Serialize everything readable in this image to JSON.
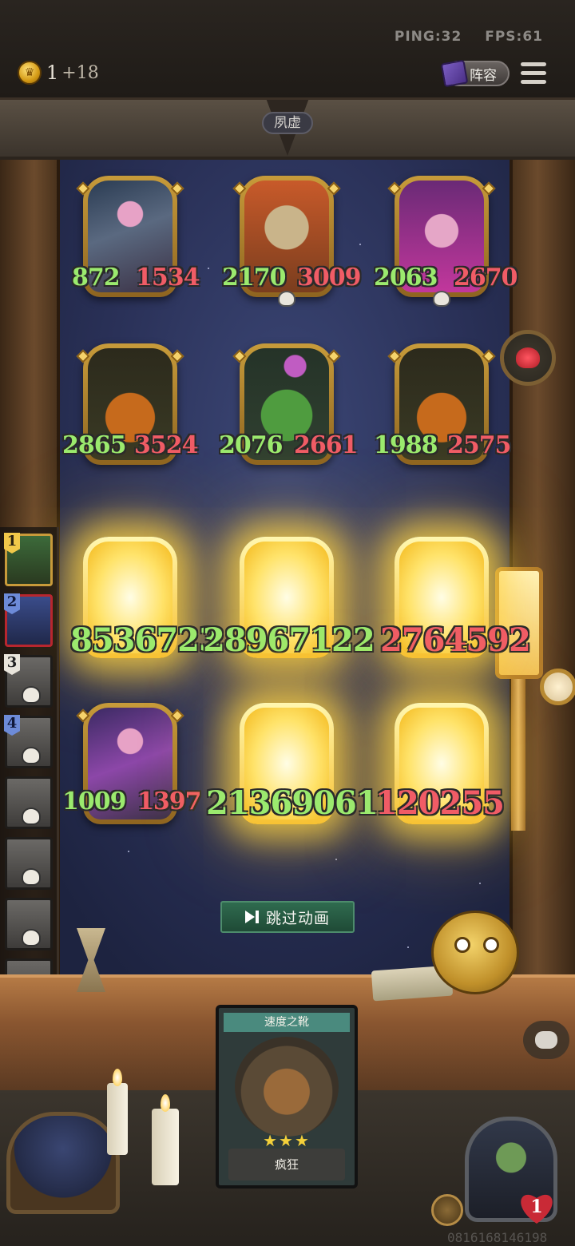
{
  "topbar": {
    "ping": "PING:32",
    "fps": "FPS:61",
    "gold_icon": "crown-coin-icon",
    "gold": "1",
    "gold_plus": "+18",
    "lineup_label": "阵容",
    "menu_icon": "hamburger-menu-icon"
  },
  "stage": {
    "name": "夙虚"
  },
  "units": [
    {
      "atk": "872",
      "hp": "1534",
      "portrait": "knight-woman"
    },
    {
      "atk": "2170",
      "hp": "3009",
      "portrait": "tree-ent"
    },
    {
      "atk": "2063",
      "hp": "2670",
      "portrait": "elf-girl"
    },
    {
      "atk": "2865",
      "hp": "3524",
      "portrait": "pumpkin-monster"
    },
    {
      "atk": "2076",
      "hp": "2661",
      "portrait": "cactus-monster"
    },
    {
      "atk": "1988",
      "hp": "2575",
      "portrait": "pumpkin-monster"
    },
    {
      "stats_text": "8536723",
      "portrait": "glowing"
    },
    {
      "stats_text": "28967122",
      "portrait": "glowing"
    },
    {
      "stats_text": "2764592",
      "portrait": "glowing"
    },
    {
      "atk": "1009",
      "hp": "1397",
      "portrait": "knight-woman-purple"
    },
    {
      "stats_text": "21369061",
      "portrait": "glowing"
    },
    {
      "stats_text": "120255",
      "portrait": "glowing"
    }
  ],
  "roster": {
    "slots": [
      {
        "num": "1",
        "status": "active"
      },
      {
        "num": "2",
        "status": "selected"
      },
      {
        "num": "3",
        "status": "dead"
      },
      {
        "num": "4",
        "status": "dead"
      },
      {
        "num": "",
        "status": "dead"
      },
      {
        "num": "",
        "status": "dead"
      },
      {
        "num": "",
        "status": "dead"
      },
      {
        "num": "",
        "status": "dead"
      }
    ]
  },
  "skip_button": {
    "label": "跳过动画",
    "icon": "skip-forward-icon"
  },
  "item_card": {
    "title": "速度之靴",
    "stars": "★★★",
    "trait": "疯狂"
  },
  "player": {
    "lives": "1"
  },
  "watermark": "0816168146198",
  "colors": {
    "atk": "#9bea6e",
    "hp": "#f05c66",
    "gold": "#f1c84a"
  }
}
